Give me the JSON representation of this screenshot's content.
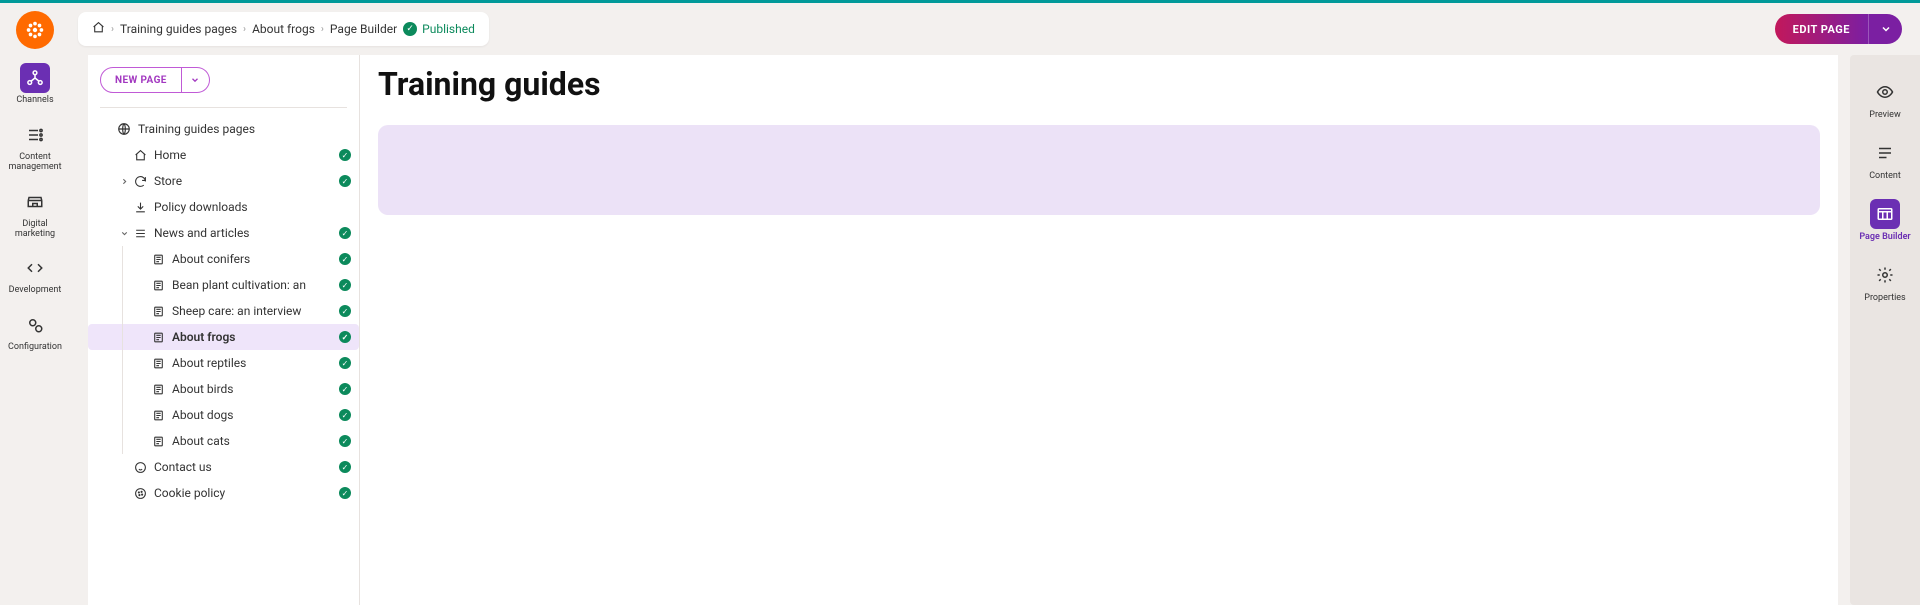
{
  "breadcrumb": {
    "items": [
      "Training guides pages",
      "About frogs",
      "Page Builder"
    ],
    "status_label": "Published"
  },
  "edit_button": {
    "label": "EDIT PAGE"
  },
  "left_rail": {
    "items": [
      {
        "label": "Channels"
      },
      {
        "label": "Content management"
      },
      {
        "label": "Digital marketing"
      },
      {
        "label": "Development"
      },
      {
        "label": "Configuration"
      }
    ]
  },
  "tree": {
    "new_page_label": "NEW PAGE",
    "root_label": "Training guides pages",
    "items": [
      {
        "label": "Home",
        "level": 1,
        "icon": "home",
        "check": true
      },
      {
        "label": "Store",
        "level": 1,
        "icon": "spin",
        "check": true,
        "expander": "right"
      },
      {
        "label": "Policy downloads",
        "level": 1,
        "icon": "download",
        "check": false
      },
      {
        "label": "News and articles",
        "level": 1,
        "icon": "list",
        "check": true,
        "expander": "down"
      },
      {
        "label": "About conifers",
        "level": 2,
        "icon": "article",
        "check": true
      },
      {
        "label": "Bean plant cultivation: an",
        "level": 2,
        "icon": "article",
        "check": true
      },
      {
        "label": "Sheep care: an interview ",
        "level": 2,
        "icon": "article",
        "check": true
      },
      {
        "label": "About frogs",
        "level": 2,
        "icon": "article",
        "check": true,
        "selected": true
      },
      {
        "label": "About reptiles",
        "level": 2,
        "icon": "article",
        "check": true
      },
      {
        "label": "About birds",
        "level": 2,
        "icon": "article",
        "check": true
      },
      {
        "label": "About dogs",
        "level": 2,
        "icon": "article",
        "check": true
      },
      {
        "label": "About cats",
        "level": 2,
        "icon": "article",
        "check": true
      },
      {
        "label": "Contact us",
        "level": 1,
        "icon": "contact",
        "check": true
      },
      {
        "label": "Cookie policy",
        "level": 1,
        "icon": "cookie",
        "check": true
      }
    ]
  },
  "canvas": {
    "title": "Training guides"
  },
  "right_rail": {
    "items": [
      {
        "label": "Preview"
      },
      {
        "label": "Content"
      },
      {
        "label": "Page Builder"
      },
      {
        "label": "Properties"
      }
    ]
  }
}
